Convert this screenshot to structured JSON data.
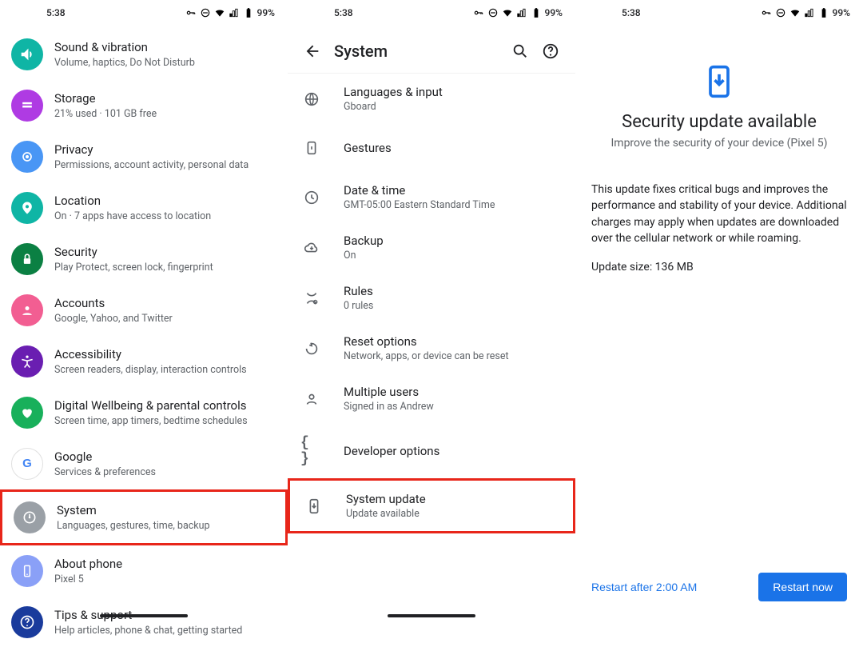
{
  "status": {
    "time": "5:38",
    "battery": "99%"
  },
  "settings": [
    {
      "icon": "volume",
      "bg": "#0fb5a5",
      "title": "Sound & vibration",
      "sub": "Volume, haptics, Do Not Disturb"
    },
    {
      "icon": "storage",
      "bg": "#af3be3",
      "title": "Storage",
      "sub": "21% used · 101 GB free"
    },
    {
      "icon": "privacy",
      "bg": "#4996f5",
      "title": "Privacy",
      "sub": "Permissions, account activity, personal data"
    },
    {
      "icon": "location",
      "bg": "#0fb5a5",
      "title": "Location",
      "sub": "On · 7 apps have access to location"
    },
    {
      "icon": "security",
      "bg": "#0b8043",
      "title": "Security",
      "sub": "Play Protect, screen lock, fingerprint"
    },
    {
      "icon": "accounts",
      "bg": "#f25e92",
      "title": "Accounts",
      "sub": "Google, Yahoo, and Twitter"
    },
    {
      "icon": "accessibility",
      "bg": "#6a1eb1",
      "title": "Accessibility",
      "sub": "Screen readers, display, interaction controls"
    },
    {
      "icon": "wellbeing",
      "bg": "#18b05b",
      "title": "Digital Wellbeing & parental controls",
      "sub": "Screen time, app timers, bedtime schedules"
    },
    {
      "icon": "google",
      "bg": "#ffffff",
      "title": "Google",
      "sub": "Services & preferences"
    },
    {
      "icon": "system",
      "bg": "#9aa0a6",
      "title": "System",
      "sub": "Languages, gestures, time, backup",
      "highlight": true
    },
    {
      "icon": "about",
      "bg": "#8aa0f7",
      "title": "About phone",
      "sub": "Pixel 5"
    },
    {
      "icon": "tips",
      "bg": "#1a3b9c",
      "title": "Tips & support",
      "sub": "Help articles, phone & chat, getting started"
    }
  ],
  "system_header": {
    "title": "System"
  },
  "system_items": [
    {
      "icon": "globe",
      "title": "Languages & input",
      "sub": "Gboard"
    },
    {
      "icon": "gestures",
      "title": "Gestures",
      "sub": ""
    },
    {
      "icon": "clock",
      "title": "Date & time",
      "sub": "GMT-05:00 Eastern Standard Time"
    },
    {
      "icon": "cloud",
      "title": "Backup",
      "sub": "On"
    },
    {
      "icon": "rules",
      "title": "Rules",
      "sub": "0 rules"
    },
    {
      "icon": "reset",
      "title": "Reset options",
      "sub": "Network, apps, or device can be reset"
    },
    {
      "icon": "users",
      "title": "Multiple users",
      "sub": "Signed in as Andrew"
    },
    {
      "icon": "braces",
      "title": "Developer options",
      "sub": ""
    },
    {
      "icon": "update",
      "title": "System update",
      "sub": "Update available",
      "highlight": true
    }
  ],
  "update": {
    "title": "Security update available",
    "subtitle": "Improve the security of your device (Pixel 5)",
    "body": "This update fixes critical bugs and improves the performance and stability of your device. Additional charges may apply when updates are downloaded over the cellular network or while roaming.",
    "size": "Update size: 136 MB",
    "restart_after": "Restart after 2:00 AM",
    "restart_now": "Restart now"
  }
}
